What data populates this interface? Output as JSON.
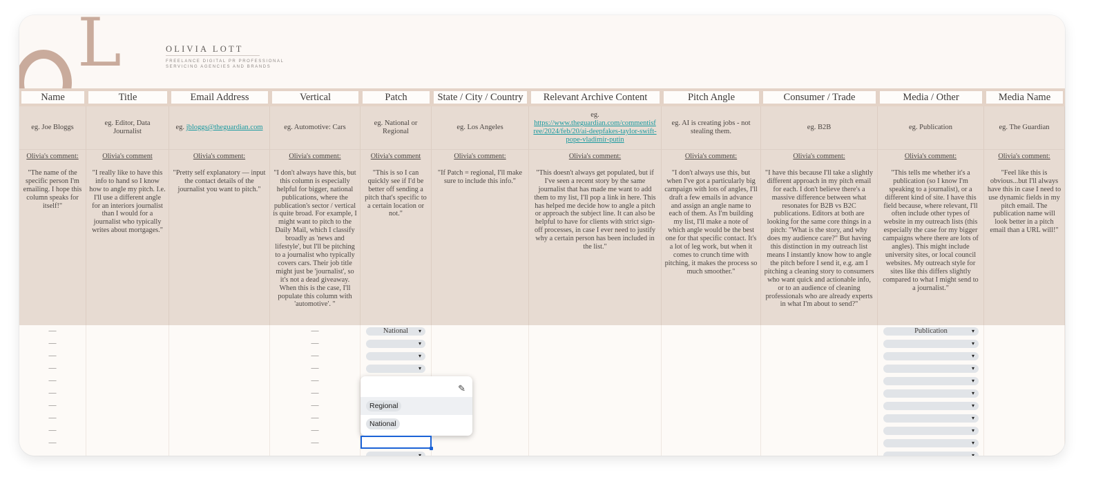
{
  "banner": {
    "logo_letter_top": "L",
    "brand_name": "OLIVIA LOTT",
    "tagline_line1": "FREELANCE DIGITAL PR PROFESSIONAL",
    "tagline_line2": "SERVICING AGENCIES AND BRANDS"
  },
  "columns": [
    {
      "header": "Name",
      "example": "eg. Joe Bloggs",
      "comment_label": "Olivia's comment:",
      "comment": "\"The name of the specific person I'm emailing. I hope this column speaks for itself!\""
    },
    {
      "header": "Title",
      "example": "eg. Editor, Data Journalist",
      "comment_label": "Olivia's comment",
      "comment": "\"I really like to have this info to hand so I know how to angle my pitch. I.e. I'll use a different angle for an interiors journalist than I would for a journalist who typically writes about mortgages.\""
    },
    {
      "header": "Email Address",
      "example_prefix": "eg. ",
      "example_link": "jbloggs@theguardian.com",
      "comment_label": "Olivia's comment:",
      "comment": "\"Pretty self explanatory — input the contact details of the journalist you want to pitch.\""
    },
    {
      "header": "Vertical",
      "example": "eg. Automotive: Cars",
      "comment_label": "Olivia's comment:",
      "comment": "\"I don't always have this, but this column is especially helpful for bigger, national publications, where the publication's sector / vertical is quite broad. For example, I might want to pitch to the Daily Mail, which I classify broadly as 'news and lifestyle', but I'll be pitching to a journalist who typically covers cars. Their job title might just be 'journalist', so it's not a dead giveaway. When this is the case, I'll populate this column with 'automotive'. \""
    },
    {
      "header": "Patch",
      "example": "eg. National or Regional",
      "comment_label": "Olivia's comment",
      "comment": "\"This is so I can quickly see if I'd be better off sending a pitch that's specific to a certain location or not.\""
    },
    {
      "header": "State / City / Country",
      "example": "eg. Los Angeles",
      "comment_label": "Olivia's comment:",
      "comment": "\"If Patch = regional, I'll make sure to include this info.\""
    },
    {
      "header": "Relevant Archive Content",
      "example_prefix": "eg.",
      "example_link": "https://www.theguardian.com/commentisfree/2024/feb/20/ai-deepfakes-taylor-swift-pope-vladimir-putin",
      "comment_label": "Olivia's comment:",
      "comment": "\"This doesn't always get populated, but if I've seen a recent story by the same journalist that has made me want to add them to my list, I'll pop a link in here. This has helped me decide how to angle a pitch or approach the subject line. It can also be helpful to have for clients with strict sign-off processes, in case I ever need to justify why a certain person has been included in the list.\""
    },
    {
      "header": "Pitch Angle",
      "example": "eg. AI is creating jobs - not stealing them.",
      "comment_label": "Olivia's comment:",
      "comment": "\"I don't always use this, but when I've got a particularly big campaign with lots of angles, I'll draft a few emails in advance and assign an angle name to each of them. As I'm building my list, I'll make a note of which angle would be the best one for that specific contact. It's a lot of leg work, but when it comes to crunch time with pitching, it makes the process so much smoother.\""
    },
    {
      "header": "Consumer / Trade",
      "example": "eg. B2B",
      "comment_label": "Olivia's comment:",
      "comment": "\"I have this because I'll take a slightly different approach in my pitch email for each. I don't believe there's a massive difference between what resonates for B2B vs B2C publications. Editors at both are looking for the same core things in a pitch: \"What is the story, and why does my audience care?\" But having this distinction in my outreach list means I instantly know how to angle the pitch before I send it, e.g. am I pitching a cleaning story to consumers who want quick and actionable info, or to an audience of cleaning professionals who are already experts in what I'm about to send?\""
    },
    {
      "header": "Media / Other",
      "example": "eg. Publication",
      "comment_label": "Olivia's comment:",
      "comment": "\"This tells me whether it's a publication (so I know I'm speaking to a journalist), or a different kind of site. I have this field because, where relevant, I'll often include other types of website in my outreach lists (this especially the case for my bigger campaigns where there are lots of angles). This might include university sites, or local council websites. My outreach style for sites like this differs slightly compared to what I might send to a journalist.\""
    },
    {
      "header": "Media Name",
      "example": "eg. The Guardian",
      "comment_label": "Olivia's comment:",
      "comment": "\"Feel like this is obvious...but I'll always have this in case I need to use dynamic fields in my pitch email. The publication name will look better in a pitch email than a URL will!\""
    }
  ],
  "rows": {
    "placeholder_dash": "—",
    "patch_values": [
      "National",
      "",
      "",
      ""
    ],
    "media_values": [
      "Publication",
      "",
      "",
      "",
      "",
      "",
      "",
      "",
      "",
      ""
    ]
  },
  "patch_dropdown": {
    "edit_icon": "pencil-icon",
    "options": [
      "Regional",
      "National"
    ],
    "highlighted": "Regional"
  },
  "icons": {
    "dropdown_caret": "▾",
    "pencil": "✎"
  }
}
